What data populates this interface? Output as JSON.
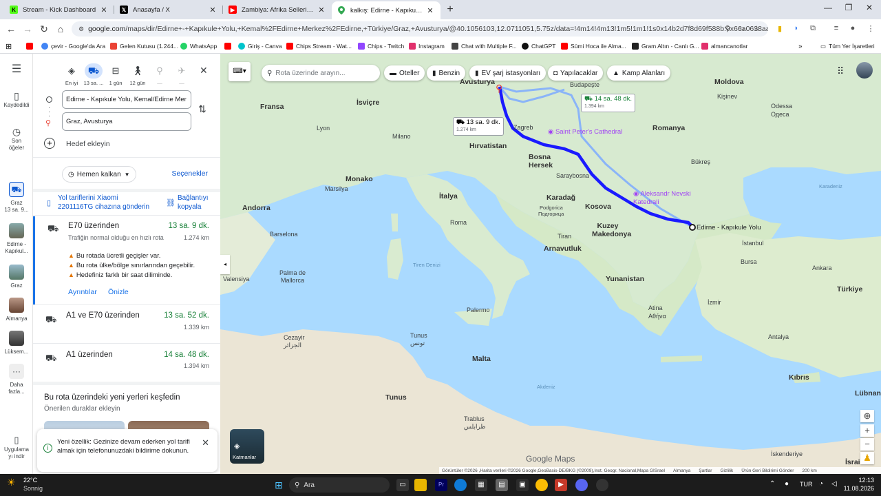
{
  "tabs": [
    {
      "title": "Stream - Kick Dashboard",
      "icon": "kick-icon"
    },
    {
      "title": "Anasayfa / X",
      "icon": "x-icon"
    },
    {
      "title": "Zambiya: Afrika Sellerine Frensı",
      "icon": "youtube-icon"
    },
    {
      "title": "kalkış: Edirne - Kapıkule Yolu ve",
      "icon": "google-maps-icon"
    }
  ],
  "address": {
    "host": "google.com",
    "path": "/maps/dir/Edirne+-+Kapıkule+Yolu,+Kemal%2FEdirne+Merkez%2FEdirne,+Türkiye/Graz,+Avusturya/@40.1056103,12.0711051,5.75z/data=!4m14!4m13!1m5!1m1!1s0x14b2d7f8d69f588b:0x66a0638aaff47daf!2..."
  },
  "bookmarks": [
    {
      "label": "çevir - Google'da Ara",
      "color": "#4285f4"
    },
    {
      "label": "Gelen Kutusu (1.244...",
      "color": "#ea4335"
    },
    {
      "label": "WhatsApp",
      "color": "#25d366"
    },
    {
      "label": "Giriş - Canva",
      "color": "#00c4cc"
    },
    {
      "label": "Chips Stream - Wat...",
      "color": "#ff0000"
    },
    {
      "label": "Chips - Twitch",
      "color": "#9146ff"
    },
    {
      "label": "Instagram",
      "color": "#e1306c"
    },
    {
      "label": "Chat with Multiple F...",
      "color": "#444444"
    },
    {
      "label": "ChatGPT",
      "color": "#111111"
    },
    {
      "label": "Sümi Hoca ile Alma...",
      "color": "#ff0000"
    },
    {
      "label": "Gram Altın - Canlı G...",
      "color": "#222222"
    },
    {
      "label": "almancanotlar",
      "color": "#e1306c"
    }
  ],
  "all_bookmarks": "Tüm Yer İşaretleri",
  "rail": {
    "saved": "Kaydedildi",
    "recent": "Son öğeler",
    "graz": "Graz",
    "graz_sub": "13 sa. 9...",
    "edirne": "Edirne - Kapıkul...",
    "graz2": "Graz",
    "almanya": "Almanya",
    "luksem": "Lüksem...",
    "more": "Daha fazla...",
    "get_app": "Uygulama yı indir"
  },
  "modes": [
    {
      "label": "En iyi",
      "icon": "diamond-icon"
    },
    {
      "label": "13 sa. ...",
      "icon": "car-icon"
    },
    {
      "label": "1 gün",
      "icon": "transit-icon"
    },
    {
      "label": "12 gün",
      "icon": "walk-icon"
    },
    {
      "label": "—",
      "icon": "bike-icon"
    },
    {
      "label": "—",
      "icon": "plane-icon"
    }
  ],
  "origin": "Edirne - Kapıkule Yolu, Kemal/Edirne Mer",
  "destination": "Graz, Avusturya",
  "add_destination": "Hedef ekleyin",
  "leave_now": "Hemen kalkan",
  "options": "Seçenekler",
  "send_to_phone": "Yol tariflerini Xiaomi 2201116TG cihazına gönderin",
  "copy_link": "Bağlantıyı kopyala",
  "routes": [
    {
      "name": "E70 üzerinden",
      "time": "13 sa. 9 dk.",
      "distance": "1.274 km",
      "note": "Trafiğin normal olduğu en hızlı rota",
      "warnings": [
        "Bu rotada ücretli geçişler var.",
        "Bu rota ülke/bölge sınırlarından geçebilir.",
        "Hedefiniz farklı bir saat diliminde."
      ],
      "details": "Ayrıntılar",
      "preview": "Önizle"
    },
    {
      "name": "A1 ve E70 üzerinden",
      "time": "13 sa. 52 dk.",
      "distance": "1.339 km"
    },
    {
      "name": "A1 üzerinden",
      "time": "14 sa. 48 dk.",
      "distance": "1.394 km"
    }
  ],
  "explore": {
    "title": "Bu rota üzerindeki yeni yerleri keşfedin",
    "subtitle": "Önerilen duraklar ekleyin"
  },
  "toast": "Yeni özellik: Gezinize devam ederken yol tarifi almak için telefonunuzdaki bildirime dokunun.",
  "map": {
    "search_placeholder": "Rota üzerinde arayın...",
    "chips": [
      "Oteller",
      "Benzin",
      "EV şarj istasyonları",
      "Yapılacaklar",
      "Kamp Alanları"
    ],
    "layers": "Katmanlar",
    "brand": "Google Maps",
    "time_main": "13 sa. 9 dk.",
    "dist_main": "1.274 km",
    "time_alt": "14 sa. 48 dk.",
    "dist_alt": "1.394 km",
    "labels": {
      "fransa": "Fransa",
      "isvicre": "İsviçre",
      "avusturya": "Avusturya",
      "budapeste": "Budapeşte",
      "moldova": "Moldova",
      "kisinev": "Kişinev",
      "odessa": "Odessa",
      "odessa2": "Одеса",
      "lyon": "Lyon",
      "milano": "Milano",
      "zagreb": "Zagreb",
      "hirvatistan": "Hırvatistan",
      "romanya": "Romanya",
      "bosna": "Bosna Hersek",
      "sarajevo": "Saraybosna",
      "bukres": "Bükreş",
      "monako": "Monako",
      "marsilya": "Marsilya",
      "italya": "İtalya",
      "karadag": "Karadağ",
      "podgorica": "Podgorica",
      "podgorica2": "Подгорица",
      "kosova": "Kosova",
      "andorra": "Andorra",
      "roma": "Roma",
      "kuzey": "Kuzey Makedonya",
      "barselona": "Barselona",
      "tiran": "Tiran",
      "arnavutluk": "Arnavutluk",
      "istanbul": "İstanbul",
      "bursa": "Bursa",
      "ankara": "Ankara",
      "turkiye": "Türkiye",
      "tiren": "Tiren Denizi",
      "valensiya": "Valensiya",
      "palma": "Palma de Mallorca",
      "yunanistan": "Yunanistan",
      "atina": "Atina",
      "atina2": "Αθήνα",
      "izmir": "İzmir",
      "palermo": "Palermo",
      "cezayir": "Cezayir",
      "cezayir2": "الجزائر",
      "tunus": "Tunus",
      "tunus2": "تونس",
      "antalya": "Antalya",
      "malta": "Malta",
      "akdeniz": "Akdeniz",
      "kibris": "Kıbrıs",
      "tunus_country": "Tunus",
      "lubnan": "Lübnan",
      "trablus": "Trablus",
      "trablus2": "طرابلس",
      "iskenderiye": "İskenderiye",
      "israil": "İsrail",
      "karadeniz": "Karadeniz",
      "edirne": "Edirne - Kapıkule Yolu"
    },
    "pois": {
      "stpeter": "Saint Peter's Cathedral",
      "nevski": "Aleksandr Nevski Katedrali"
    },
    "footer": [
      "Görüntüler ©2026 ,Harita verileri ©2026 Google,GeoBasis-DE/BKG (©2009),Inst. Geogr. Nacional,Mapa GISrael",
      "Almanya",
      "Şartlar",
      "Gizlilik",
      "Ürün Geri Bildirimi Gönder",
      "200 km"
    ]
  },
  "taskbar": {
    "temp": "22°C",
    "weather": "Sonnig",
    "search": "Ara",
    "lang": "TUR",
    "time": "12:13",
    "date": "11.08.2026"
  }
}
